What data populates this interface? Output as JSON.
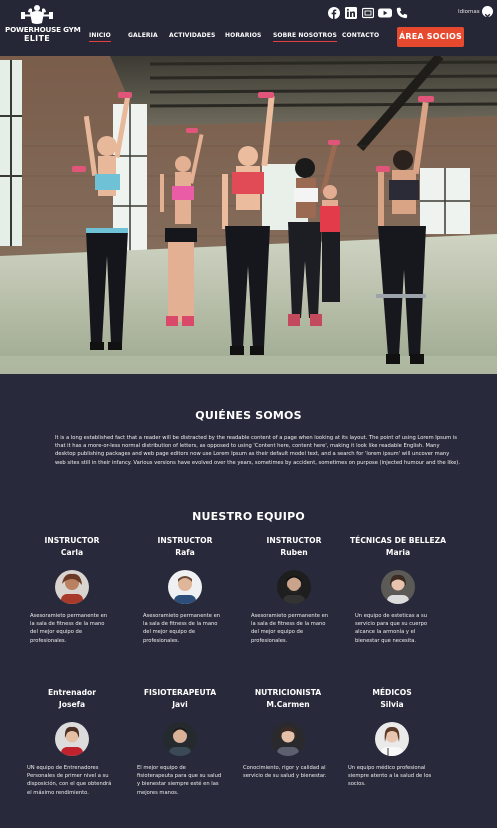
{
  "header": {
    "logo": {
      "line1": "POWERHOUSE GYM",
      "line2": "ELITE"
    },
    "nav": [
      {
        "label": "INICIO"
      },
      {
        "label": "GALERIA"
      },
      {
        "label": "ACTIVIDADES"
      },
      {
        "label": "HORARIOS"
      },
      {
        "label": "SOBRE NOSOTROS"
      },
      {
        "label": "CONTACTO"
      }
    ],
    "cta_label": "ÁREA SOCIOS",
    "social_icons": [
      "facebook-icon",
      "linkedin-icon",
      "email-icon",
      "youtube-icon",
      "phone-icon"
    ],
    "language_label": "Idiomas"
  },
  "about": {
    "title": "QUIÉNES SOMOS",
    "text": "It is a long established fact that a reader will be distracted by the readable content of a page when looking at its layout. The point of using Lorem Ipsum is that it has a more-or-less normal distribution of letters, as opposed to using 'Content here, content here', making it look like readable English. Many desktop publishing packages and web page editors now use Lorem Ipsum as their default model text, and a search for 'lorem ipsum' will uncover many web sites still in their infancy. Various versions have evolved over the years, sometimes by accident, sometimes on purpose (injected humour and the like)."
  },
  "team": {
    "title": "NUESTRO EQUIPO",
    "members": [
      {
        "role": "INSTRUCTOR",
        "name": "Carla",
        "description": "Asesoramieto permanente en la sala de fitness de la mano del mejor equipo de profesionales."
      },
      {
        "role": "INSTRUCTOR",
        "name": "Rafa",
        "description": "Asesoramieto permanente en la sala de fitness de la mano del mejor equipo de profesionales."
      },
      {
        "role": "INSTRUCTOR",
        "name": "Ruben",
        "description": "Asesoramieto permanente en la sala de fitness de la mano del mejor equipo de profesionales."
      },
      {
        "role": "TÉCNICAS DE BELLEZA",
        "name": "Maria",
        "description": "Un equipo de esteticas a su servicio para que su cuerpo alcance la armonía y el bienestar que necesita."
      },
      {
        "role": "Entrenador",
        "name": "Josefa",
        "description": "UN equipo de Entrenadores Personales de primer nivel a su disposición, con el que obtendrá el máximo rendimiento."
      },
      {
        "role": "FISIOTERAPEUTA",
        "name": "Javi",
        "description": "El mejor equipo de fisioterapeuta para que su salud y bienestar siempre esté en las mejores manos."
      },
      {
        "role": "NUTRICIONISTA",
        "name": "M.Carmen",
        "description": "Conocimiento, rigor y calidad al servicio de su salud y bienestar."
      },
      {
        "role": "MÉDICOS",
        "name": "Silvia",
        "description": "Un equipo médico profesional siempre atento a la salud de los socios."
      }
    ]
  },
  "colors": {
    "page_bg": "#28293a",
    "header_bg": "#262736",
    "accent": "#e7492e"
  }
}
